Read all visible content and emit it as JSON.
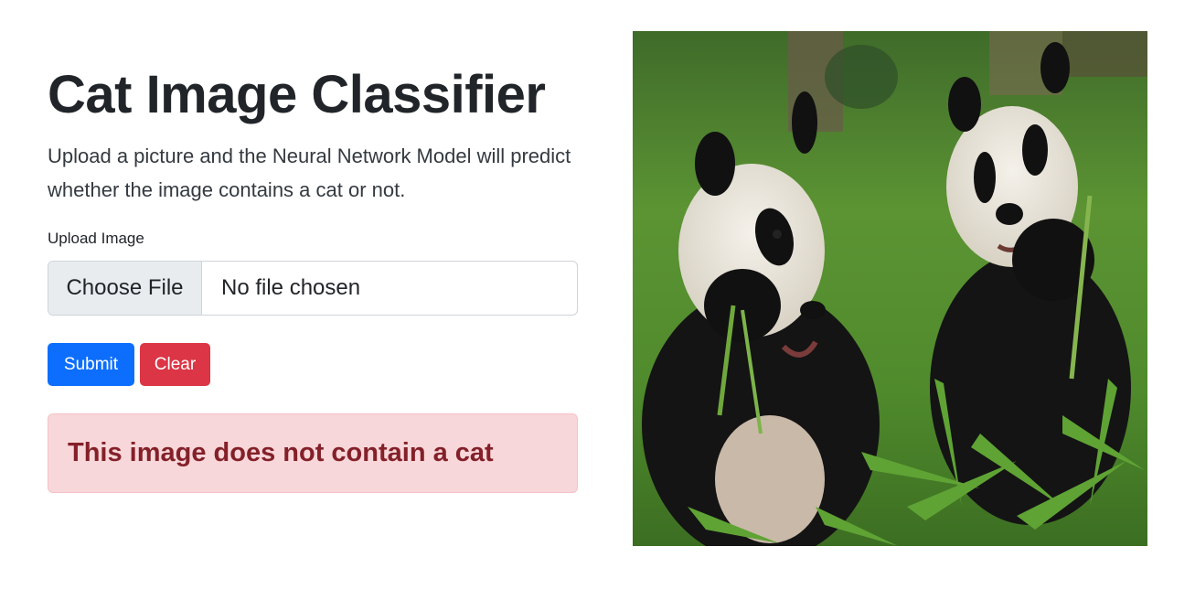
{
  "header": {
    "title": "Cat Image Classifier",
    "description": "Upload a picture and the Neural Network Model will predict whether the image contains a cat or not."
  },
  "form": {
    "upload_label": "Upload Image",
    "choose_file_label": "Choose File",
    "file_status": "No file chosen",
    "submit_label": "Submit",
    "clear_label": "Clear"
  },
  "result": {
    "message": "This image does not contain a cat",
    "status": "danger"
  },
  "preview": {
    "subject": "two giant pandas eating bamboo on grass"
  },
  "colors": {
    "primary": "#0d6efd",
    "danger": "#dc3545",
    "alert_bg": "#f8d7da",
    "alert_text": "#842029"
  }
}
